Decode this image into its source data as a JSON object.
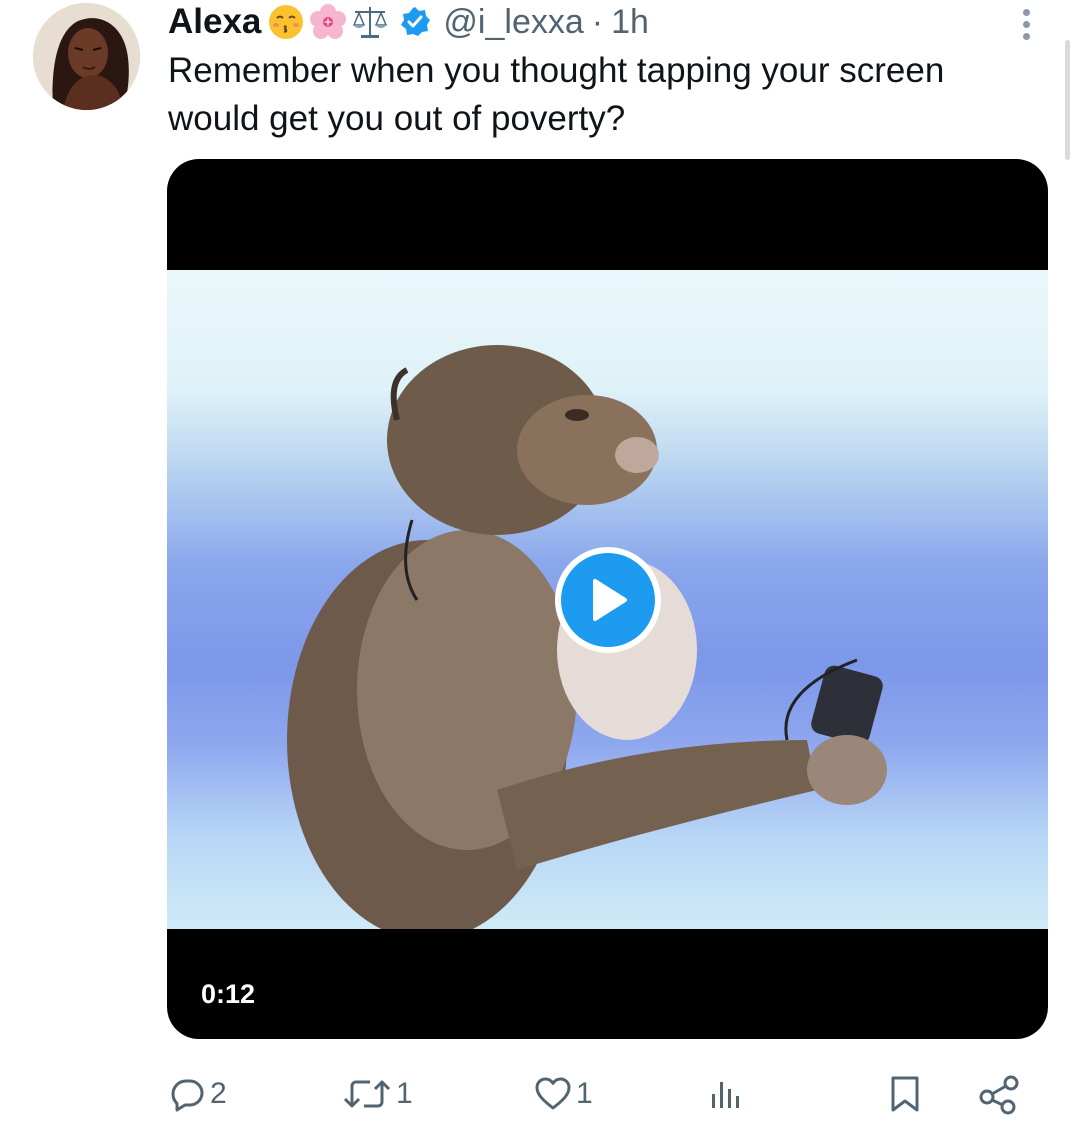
{
  "tweet": {
    "author_name": "Alexa",
    "handle": "@i_lexxa",
    "separator": "·",
    "time": "1h",
    "text": "Remember when you thought tapping your screen would get you out of poverty?",
    "emojis": [
      "kissing-face-emoji",
      "cherry-blossom-emoji",
      "balance-scale-emoji"
    ]
  },
  "media": {
    "type": "video",
    "duration": "0:12"
  },
  "actions": {
    "replies": "2",
    "reposts": "1",
    "likes": "1"
  },
  "colors": {
    "accent": "#1d9bf0",
    "secondary_text": "#536471",
    "primary_text": "#0f1419"
  }
}
